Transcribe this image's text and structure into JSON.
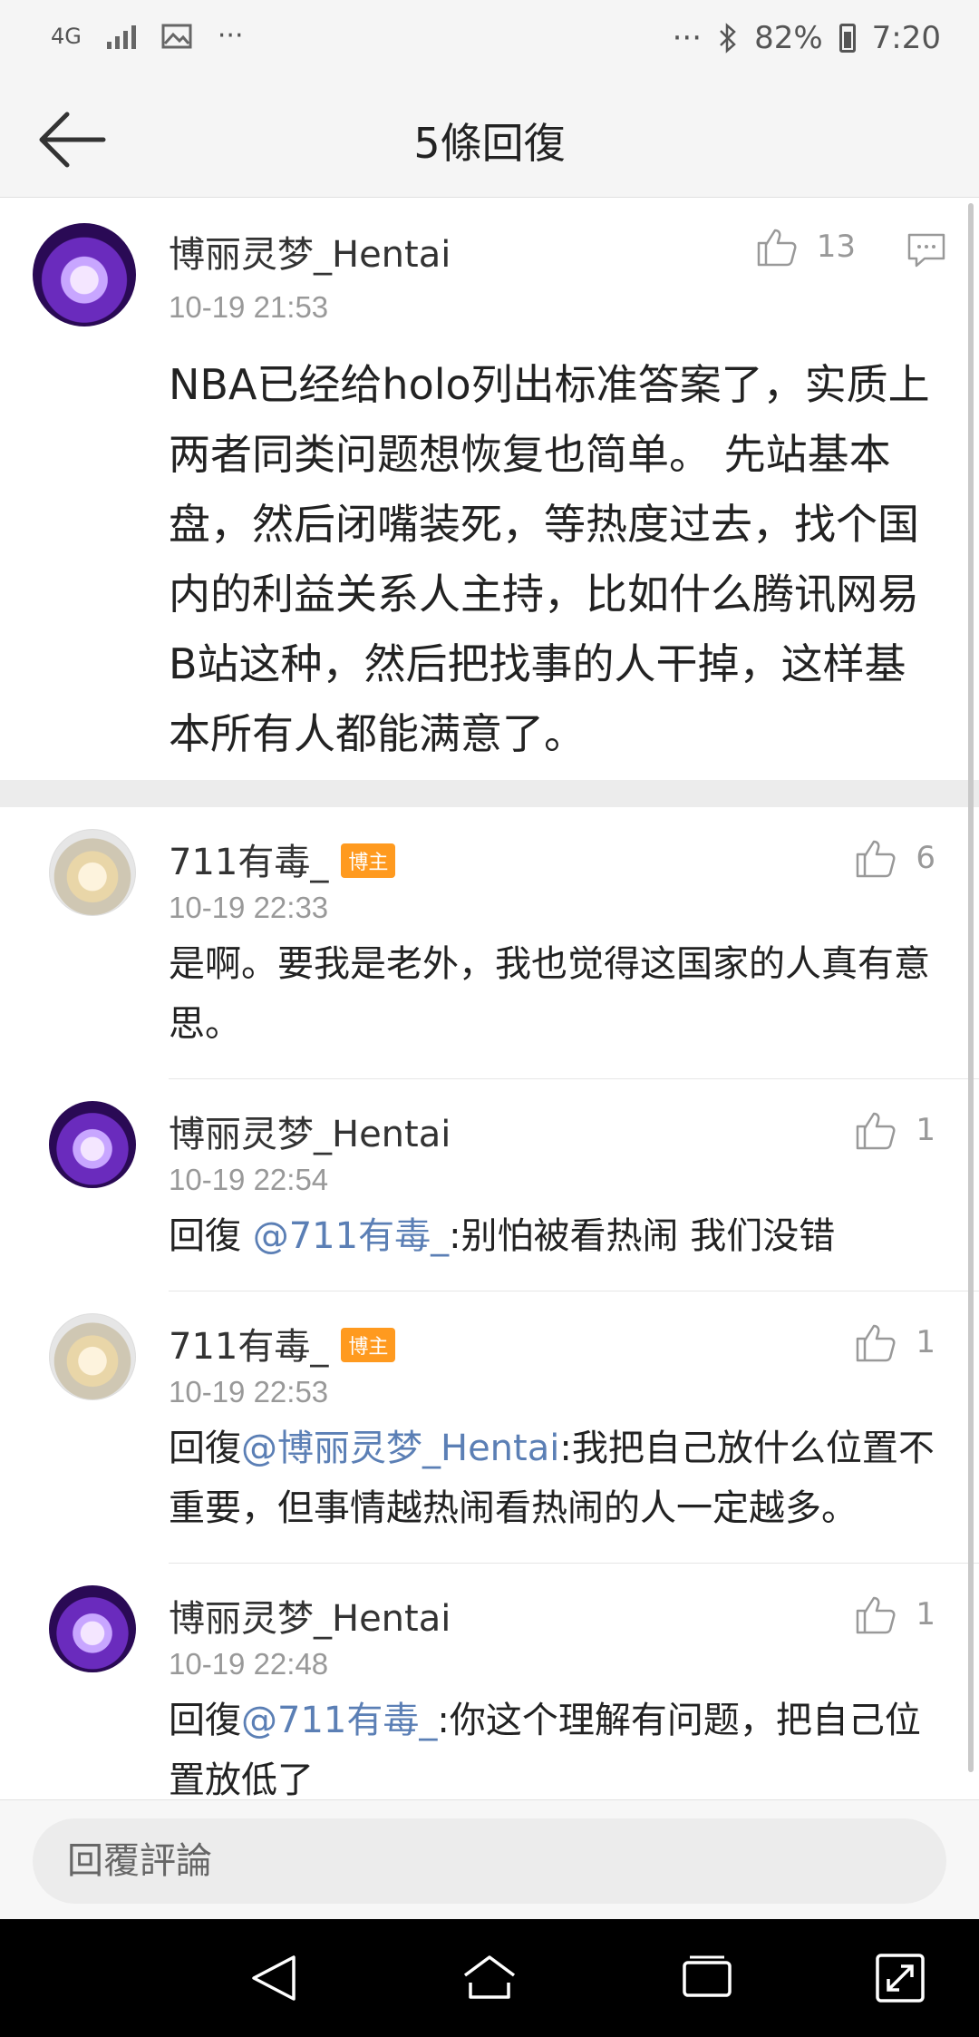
{
  "status_bar": {
    "network": "4G",
    "more_left": "···",
    "more_right": "···",
    "battery": "82%",
    "time": "7:20"
  },
  "header": {
    "title": "5條回復"
  },
  "main_comment": {
    "username": "博丽灵梦_Hentai",
    "time": "10-19 21:53",
    "likes": "13",
    "text": "NBA已经给holo列出标准答案了，实质上两者同类问题想恢复也简单。 先站基本盘，然后闭嘴装死，等热度过去，找个国内的利益关系人主持，比如什么腾讯网易B站这种，然后把找事的人干掉，这样基本所有人都能满意了。"
  },
  "replies": [
    {
      "username": "711有毒_",
      "badge": "博主",
      "time": "10-19 22:33",
      "likes": "6",
      "prefix": "",
      "mention": "",
      "text": "是啊。要我是老外，我也觉得这国家的人真有意思。"
    },
    {
      "username": "博丽灵梦_Hentai",
      "badge": "",
      "time": "10-19 22:54",
      "likes": "1",
      "prefix": "回復 ",
      "mention": "@711有毒_",
      "text": ":别怕被看热闹 我们没错"
    },
    {
      "username": "711有毒_",
      "badge": "博主",
      "time": "10-19 22:53",
      "likes": "1",
      "prefix": "回復",
      "mention": "@博丽灵梦_Hentai",
      "text": ":我把自己放什么位置不重要，但事情越热闹看热闹的人一定越多。"
    },
    {
      "username": "博丽灵梦_Hentai",
      "badge": "",
      "time": "10-19 22:48",
      "likes": "1",
      "prefix": "回復",
      "mention": "@711有毒_",
      "text": ":你这个理解有问题，把自己位置放低了"
    }
  ],
  "reply_box": {
    "placeholder": "回覆評論"
  },
  "icons": {
    "back": "arrow-left-icon",
    "like": "thumbs-up-icon",
    "comment": "comment-icon",
    "nav_back": "triangle-back-icon",
    "nav_home": "home-icon",
    "nav_recent": "recent-apps-icon",
    "nav_expand": "expand-icon"
  },
  "colors": {
    "mention": "#5b7fb5",
    "badge": "#ff9a1f"
  }
}
